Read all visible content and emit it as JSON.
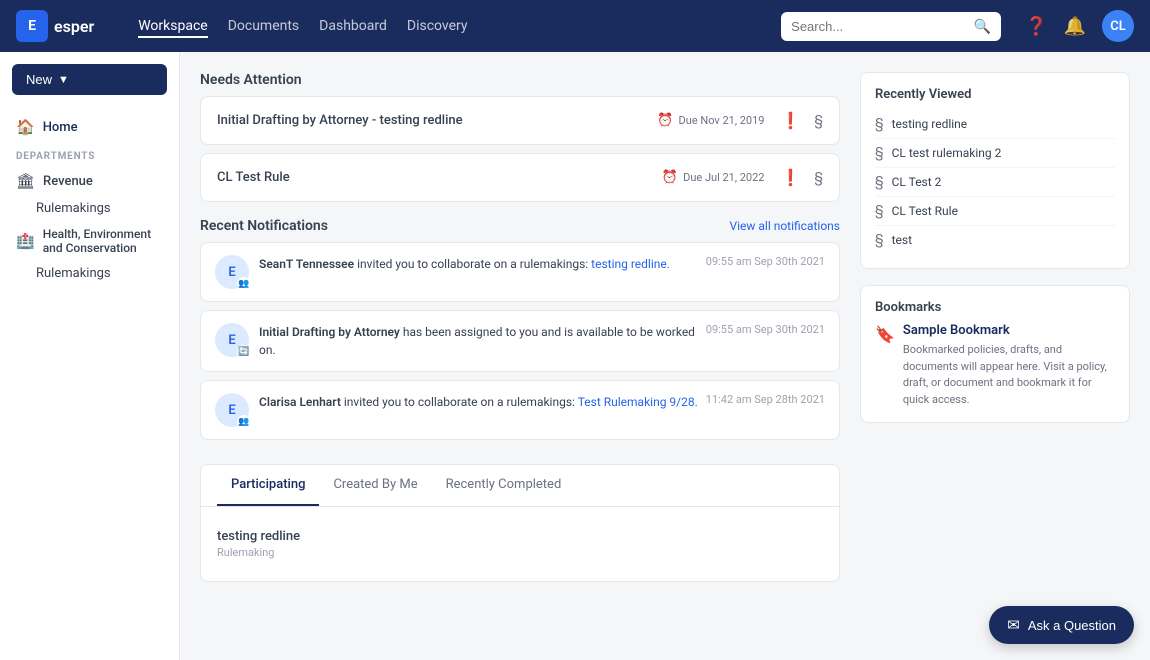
{
  "header": {
    "logo_text": "esper",
    "logo_initial": "E",
    "nav_items": [
      {
        "label": "Workspace",
        "active": true
      },
      {
        "label": "Documents",
        "active": false
      },
      {
        "label": "Dashboard",
        "active": false
      },
      {
        "label": "Discovery",
        "active": false
      }
    ],
    "search_placeholder": "Search...",
    "user_initials": "CL"
  },
  "sidebar": {
    "new_button": "New",
    "home_label": "Home",
    "departments_header": "DEPARTMENTS",
    "departments": [
      {
        "name": "Revenue",
        "sub_items": [
          "Rulemakings"
        ]
      },
      {
        "name": "Health, Environment and Conservation",
        "sub_items": [
          "Rulemakings"
        ]
      }
    ]
  },
  "main": {
    "needs_attention": {
      "title": "Needs Attention",
      "items": [
        {
          "title": "Initial Drafting by Attorney - testing redline",
          "due_label": "Due Nov 21, 2019"
        },
        {
          "title": "CL Test Rule",
          "due_label": "Due Jul 21, 2022"
        }
      ]
    },
    "recent_notifications": {
      "title": "Recent Notifications",
      "view_all_label": "View all notifications",
      "items": [
        {
          "avatar": "E",
          "badge": "👥",
          "text_before": "SeanT Tennessee",
          "text_middle": " invited you to collaborate on a rulemakings: ",
          "link_text": "testing redline.",
          "time": "09:55 am Sep 30th 2021"
        },
        {
          "avatar": "E",
          "badge": "🔄",
          "text_before": "Initial Drafting by Attorney",
          "text_middle": " has been assigned to you and is available to be worked on.",
          "link_text": "",
          "time": "09:55 am Sep 30th 2021"
        },
        {
          "avatar": "E",
          "badge": "👥",
          "text_before": "Clarisa Lenhart",
          "text_middle": " invited you to collaborate on a rulemakings: ",
          "link_text": "Test Rulemaking 9/28.",
          "time": "11:42 am Sep 28th 2021"
        }
      ]
    },
    "tabs": {
      "items": [
        {
          "label": "Participating",
          "active": true
        },
        {
          "label": "Created By Me",
          "active": false
        },
        {
          "label": "Recently Completed",
          "active": false
        }
      ],
      "content": [
        {
          "title": "testing redline",
          "subtitle": "Rulemaking"
        }
      ]
    }
  },
  "right_panel": {
    "recently_viewed": {
      "title": "Recently Viewed",
      "items": [
        {
          "label": "testing redline"
        },
        {
          "label": "CL test rulemaking 2"
        },
        {
          "label": "CL Test 2"
        },
        {
          "label": "CL Test Rule"
        },
        {
          "label": "test"
        }
      ]
    },
    "bookmarks": {
      "title": "Bookmarks",
      "sample": {
        "title": "Sample Bookmark",
        "description": "Bookmarked policies, drafts, and documents will appear here. Visit a policy, draft, or document and bookmark it for quick access."
      }
    }
  },
  "ask_button": {
    "label": "Ask a Question"
  }
}
